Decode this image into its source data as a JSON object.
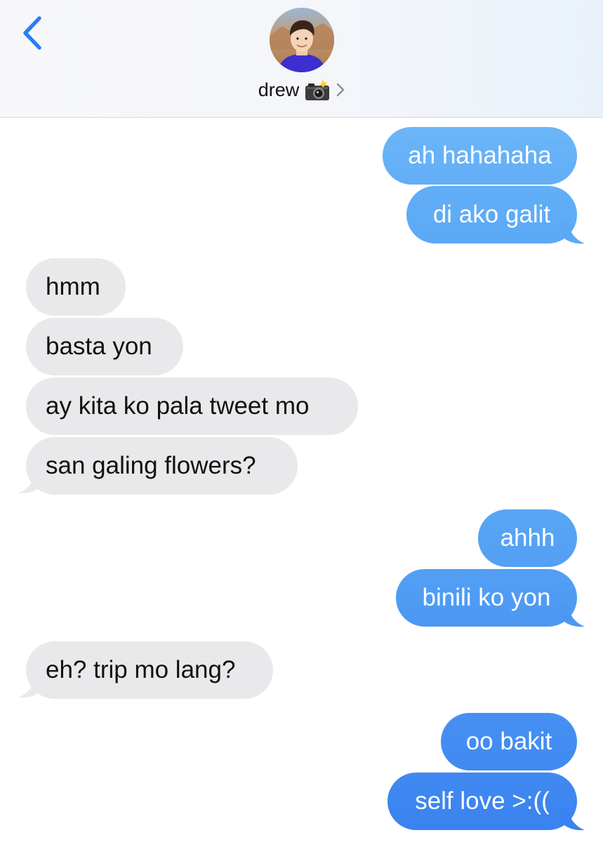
{
  "colors": {
    "sent_bubble_top": "#6bb5f8",
    "sent_bubble_bottom": "#3a8af0",
    "received_bubble": "#e9e9eb",
    "back_arrow": "#2c7df6"
  },
  "header": {
    "contact_name": "drew",
    "contact_emoji": "📸",
    "back_icon": "chevron-left-icon",
    "disclosure_icon": "chevron-right-icon"
  },
  "messages": [
    {
      "direction": "sent",
      "text": "ah hahahaha"
    },
    {
      "direction": "sent",
      "text": "di ako galit"
    },
    {
      "direction": "received",
      "text": "hmm"
    },
    {
      "direction": "received",
      "text": "basta yon"
    },
    {
      "direction": "received",
      "text": "ay kita ko pala tweet mo"
    },
    {
      "direction": "received",
      "text": "san galing flowers?"
    },
    {
      "direction": "sent",
      "text": "ahhh"
    },
    {
      "direction": "sent",
      "text": "binili ko yon"
    },
    {
      "direction": "received",
      "text": "eh? trip mo lang?"
    },
    {
      "direction": "sent",
      "text": "oo bakit"
    },
    {
      "direction": "sent",
      "text": "self love >:(("
    }
  ]
}
